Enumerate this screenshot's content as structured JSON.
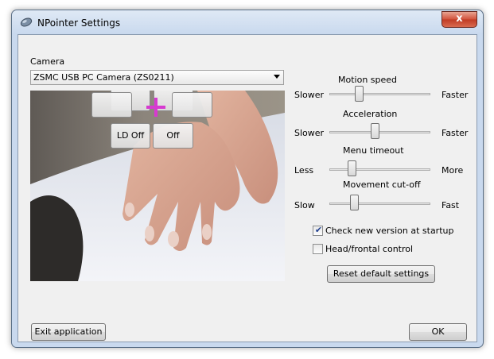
{
  "window": {
    "title": "NPointer Settings",
    "close_glyph": "x"
  },
  "camera": {
    "label": "Camera",
    "selected": "ZSMC USB PC Camera (ZS0211)",
    "overlay_buttons": {
      "top_left": "",
      "top_right": "",
      "mid_left": "",
      "mid_right": "",
      "ld_off": "LD Off",
      "off": "Off"
    },
    "crosshair_color": "#d63ad0"
  },
  "sliders": [
    {
      "title": "Motion speed",
      "min_label": "Slower",
      "max_label": "Faster",
      "value": 0.28
    },
    {
      "title": "Acceleration",
      "min_label": "Slower",
      "max_label": "Faster",
      "value": 0.45
    },
    {
      "title": "Menu timeout",
      "min_label": "Less",
      "max_label": "More",
      "value": 0.2
    },
    {
      "title": "Movement cut-off",
      "min_label": "Slow",
      "max_label": "Fast",
      "value": 0.22
    }
  ],
  "options": {
    "check_version": {
      "label": "Check new version at startup",
      "checked": true
    },
    "head_control": {
      "label": "Head/frontal control",
      "checked": false
    }
  },
  "buttons": {
    "reset": "Reset default settings",
    "exit": "Exit application",
    "ok": "OK"
  }
}
